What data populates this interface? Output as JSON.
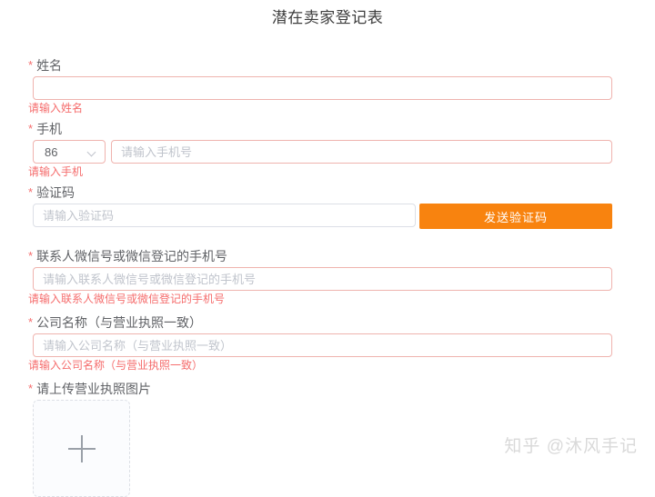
{
  "title": "潜在卖家登记表",
  "required_marker": "*",
  "form": {
    "name": {
      "label": "姓名",
      "value": "",
      "error": "请输入姓名"
    },
    "phone": {
      "label": "手机",
      "country_code": "86",
      "placeholder": "请输入手机号",
      "value": "",
      "error": "请输入手机"
    },
    "code": {
      "label": "验证码",
      "placeholder": "请输入验证码",
      "value": "",
      "send_button_label": "发送验证码"
    },
    "wechat": {
      "label": "联系人微信号或微信登记的手机号",
      "placeholder": "请输入联系人微信号或微信登记的手机号",
      "value": "",
      "error": "请输入联系人微信号或微信登记的手机号"
    },
    "company": {
      "label": "公司名称（与营业执照一致）",
      "placeholder": "请输入公司名称（与营业执照一致）",
      "value": "",
      "error": "请输入公司名称（与营业执照一致）"
    },
    "license": {
      "label": "请上传营业执照图片"
    }
  },
  "icons": {
    "country_select": "chevron-down-icon",
    "upload": "plus-icon"
  },
  "colors": {
    "accent_orange": "#F8830F",
    "error_text": "#F56C6C",
    "error_border": "#EFB3AE",
    "input_border": "#DCDFE6",
    "placeholder": "#C0C4CC",
    "label": "#606266",
    "title": "#3D3D3D",
    "watermark": "#D9D9D9"
  },
  "watermark": "知乎 @沐风手记"
}
